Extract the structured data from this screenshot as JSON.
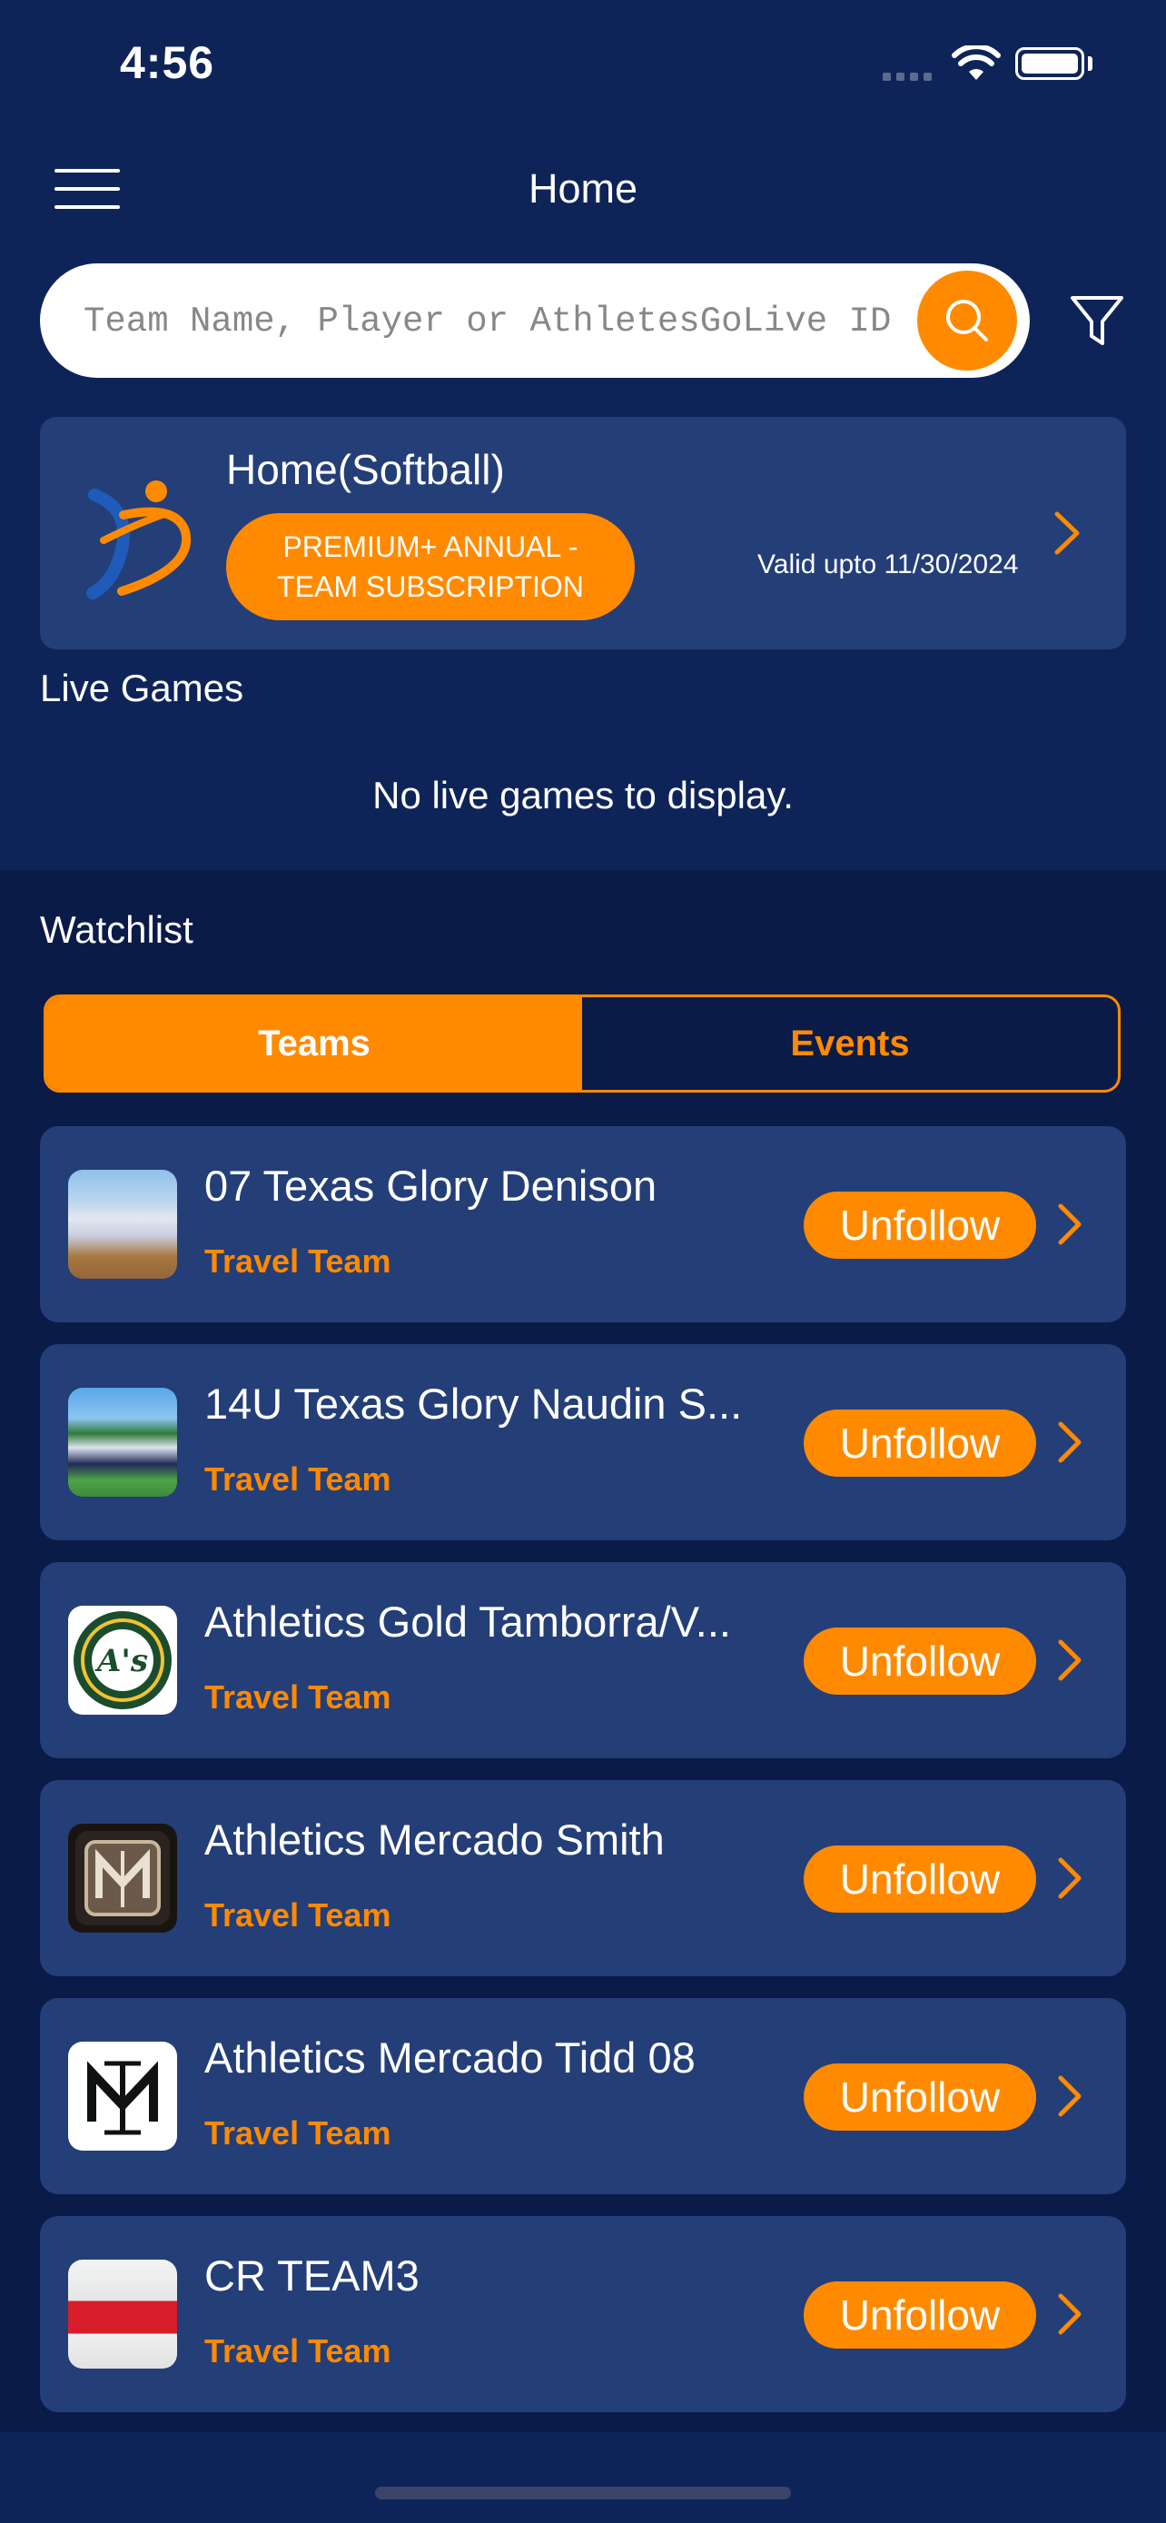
{
  "status": {
    "time": "4:56"
  },
  "header": {
    "title": "Home"
  },
  "search": {
    "placeholder": "Team Name, Player or AthletesGoLive ID"
  },
  "team_card": {
    "name": "Home(Softball)",
    "subscription_line1": "PREMIUM+ ANNUAL -",
    "subscription_line2": "TEAM SUBSCRIPTION",
    "valid": "Valid upto 11/30/2024"
  },
  "live": {
    "label": "Live Games",
    "empty": "No live games to display."
  },
  "watchlist": {
    "label": "Watchlist",
    "tabs": [
      "Teams",
      "Events"
    ],
    "items": [
      {
        "name": "07 Texas Glory Denison",
        "type": "Travel Team",
        "button": "Unfollow"
      },
      {
        "name": "14U Texas Glory Naudin S...",
        "type": "Travel Team",
        "button": "Unfollow"
      },
      {
        "name": "Athletics Gold Tamborra/V...",
        "type": "Travel Team",
        "button": "Unfollow"
      },
      {
        "name": "Athletics Mercado Smith",
        "type": "Travel Team",
        "button": "Unfollow"
      },
      {
        "name": "Athletics Mercado Tidd 08",
        "type": "Travel Team",
        "button": "Unfollow"
      },
      {
        "name": "CR TEAM3",
        "type": "Travel Team",
        "button": "Unfollow"
      }
    ]
  },
  "colors": {
    "accent": "#ff8a00",
    "background": "#0e2459",
    "card": "#243e78"
  }
}
